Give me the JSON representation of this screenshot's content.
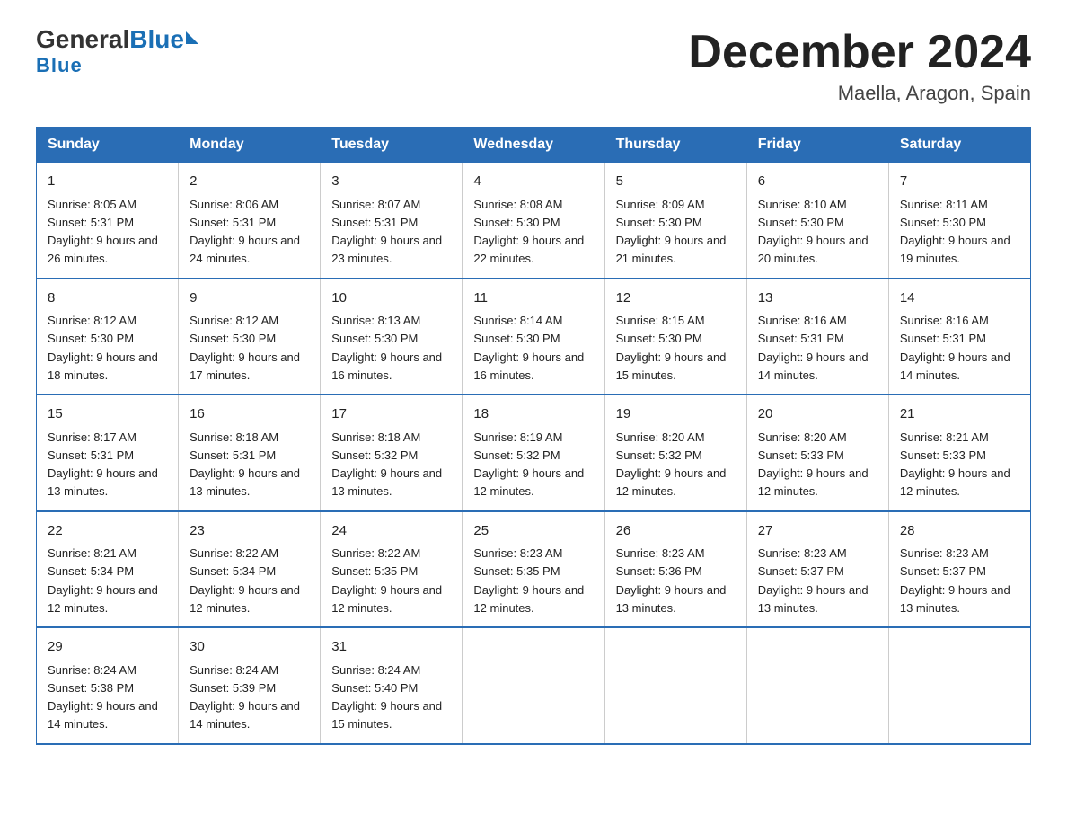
{
  "logo": {
    "general": "General",
    "blue": "Blue",
    "underline": "Blue"
  },
  "title": "December 2024",
  "subtitle": "Maella, Aragon, Spain",
  "headers": [
    "Sunday",
    "Monday",
    "Tuesday",
    "Wednesday",
    "Thursday",
    "Friday",
    "Saturday"
  ],
  "weeks": [
    [
      {
        "day": "1",
        "sunrise": "8:05 AM",
        "sunset": "5:31 PM",
        "daylight": "9 hours and 26 minutes."
      },
      {
        "day": "2",
        "sunrise": "8:06 AM",
        "sunset": "5:31 PM",
        "daylight": "9 hours and 24 minutes."
      },
      {
        "day": "3",
        "sunrise": "8:07 AM",
        "sunset": "5:31 PM",
        "daylight": "9 hours and 23 minutes."
      },
      {
        "day": "4",
        "sunrise": "8:08 AM",
        "sunset": "5:30 PM",
        "daylight": "9 hours and 22 minutes."
      },
      {
        "day": "5",
        "sunrise": "8:09 AM",
        "sunset": "5:30 PM",
        "daylight": "9 hours and 21 minutes."
      },
      {
        "day": "6",
        "sunrise": "8:10 AM",
        "sunset": "5:30 PM",
        "daylight": "9 hours and 20 minutes."
      },
      {
        "day": "7",
        "sunrise": "8:11 AM",
        "sunset": "5:30 PM",
        "daylight": "9 hours and 19 minutes."
      }
    ],
    [
      {
        "day": "8",
        "sunrise": "8:12 AM",
        "sunset": "5:30 PM",
        "daylight": "9 hours and 18 minutes."
      },
      {
        "day": "9",
        "sunrise": "8:12 AM",
        "sunset": "5:30 PM",
        "daylight": "9 hours and 17 minutes."
      },
      {
        "day": "10",
        "sunrise": "8:13 AM",
        "sunset": "5:30 PM",
        "daylight": "9 hours and 16 minutes."
      },
      {
        "day": "11",
        "sunrise": "8:14 AM",
        "sunset": "5:30 PM",
        "daylight": "9 hours and 16 minutes."
      },
      {
        "day": "12",
        "sunrise": "8:15 AM",
        "sunset": "5:30 PM",
        "daylight": "9 hours and 15 minutes."
      },
      {
        "day": "13",
        "sunrise": "8:16 AM",
        "sunset": "5:31 PM",
        "daylight": "9 hours and 14 minutes."
      },
      {
        "day": "14",
        "sunrise": "8:16 AM",
        "sunset": "5:31 PM",
        "daylight": "9 hours and 14 minutes."
      }
    ],
    [
      {
        "day": "15",
        "sunrise": "8:17 AM",
        "sunset": "5:31 PM",
        "daylight": "9 hours and 13 minutes."
      },
      {
        "day": "16",
        "sunrise": "8:18 AM",
        "sunset": "5:31 PM",
        "daylight": "9 hours and 13 minutes."
      },
      {
        "day": "17",
        "sunrise": "8:18 AM",
        "sunset": "5:32 PM",
        "daylight": "9 hours and 13 minutes."
      },
      {
        "day": "18",
        "sunrise": "8:19 AM",
        "sunset": "5:32 PM",
        "daylight": "9 hours and 12 minutes."
      },
      {
        "day": "19",
        "sunrise": "8:20 AM",
        "sunset": "5:32 PM",
        "daylight": "9 hours and 12 minutes."
      },
      {
        "day": "20",
        "sunrise": "8:20 AM",
        "sunset": "5:33 PM",
        "daylight": "9 hours and 12 minutes."
      },
      {
        "day": "21",
        "sunrise": "8:21 AM",
        "sunset": "5:33 PM",
        "daylight": "9 hours and 12 minutes."
      }
    ],
    [
      {
        "day": "22",
        "sunrise": "8:21 AM",
        "sunset": "5:34 PM",
        "daylight": "9 hours and 12 minutes."
      },
      {
        "day": "23",
        "sunrise": "8:22 AM",
        "sunset": "5:34 PM",
        "daylight": "9 hours and 12 minutes."
      },
      {
        "day": "24",
        "sunrise": "8:22 AM",
        "sunset": "5:35 PM",
        "daylight": "9 hours and 12 minutes."
      },
      {
        "day": "25",
        "sunrise": "8:23 AM",
        "sunset": "5:35 PM",
        "daylight": "9 hours and 12 minutes."
      },
      {
        "day": "26",
        "sunrise": "8:23 AM",
        "sunset": "5:36 PM",
        "daylight": "9 hours and 13 minutes."
      },
      {
        "day": "27",
        "sunrise": "8:23 AM",
        "sunset": "5:37 PM",
        "daylight": "9 hours and 13 minutes."
      },
      {
        "day": "28",
        "sunrise": "8:23 AM",
        "sunset": "5:37 PM",
        "daylight": "9 hours and 13 minutes."
      }
    ],
    [
      {
        "day": "29",
        "sunrise": "8:24 AM",
        "sunset": "5:38 PM",
        "daylight": "9 hours and 14 minutes."
      },
      {
        "day": "30",
        "sunrise": "8:24 AM",
        "sunset": "5:39 PM",
        "daylight": "9 hours and 14 minutes."
      },
      {
        "day": "31",
        "sunrise": "8:24 AM",
        "sunset": "5:40 PM",
        "daylight": "9 hours and 15 minutes."
      },
      null,
      null,
      null,
      null
    ]
  ]
}
